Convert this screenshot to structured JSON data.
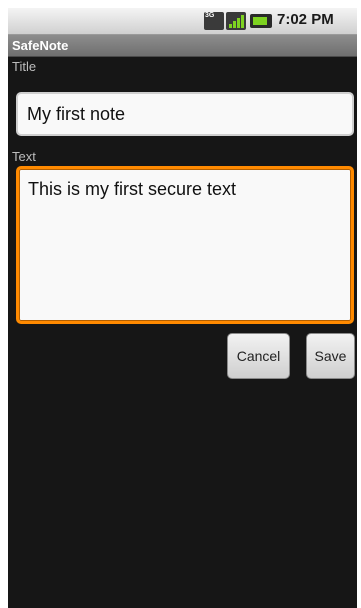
{
  "status_bar": {
    "network_label": "3G",
    "time": "7:02 PM",
    "icons": [
      "network-3g-icon",
      "signal-strength-icon",
      "battery-icon"
    ],
    "accent_color": "#7ed321"
  },
  "app": {
    "title": "SafeNote"
  },
  "form": {
    "title_label": "Title",
    "title_value": "My first note",
    "text_label": "Text",
    "text_value": "This is my first secure text",
    "focus_color": "#ff8a00"
  },
  "buttons": {
    "cancel_label": "Cancel",
    "save_label": "Save"
  }
}
